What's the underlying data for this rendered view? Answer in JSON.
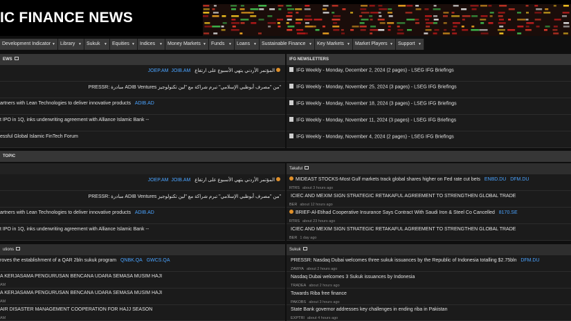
{
  "banner": {
    "title": "IC FINANCE NEWS"
  },
  "nav": {
    "items": [
      {
        "label": "Development Indicator"
      },
      {
        "label": "Library"
      },
      {
        "label": "Sukuk"
      },
      {
        "label": "Equities"
      },
      {
        "label": "Indices"
      },
      {
        "label": "Money Markets"
      },
      {
        "label": "Funds"
      },
      {
        "label": "Loans"
      },
      {
        "label": "Sustainable Finance"
      },
      {
        "label": "Key Markets"
      },
      {
        "label": "Market Players"
      },
      {
        "label": "Support"
      }
    ]
  },
  "news": {
    "title": "EWS",
    "rows": [
      {
        "text": "المؤتمر الأردني يتهي الأسبوع على ارتفاع",
        "links": [
          "JOEP.AM",
          "JOIB.AM"
        ]
      },
      {
        "text": "PRESSR: مبادرة ADIB Ventures من \"مصرف أبوظبي الإسلامي\" تبرم شراكة مع \"لين تكنولوجيز\"",
        "links": []
      },
      {
        "text": "artners with Lean Technologies to deliver innovative products",
        "links": [
          "ADIB.AD"
        ]
      },
      {
        "text": "t IPO in 1Q, inks underwriting agreement with Alliance Islamic Bank --",
        "links": []
      },
      {
        "text": "essful Global Islamic FinTech Forum",
        "links": []
      }
    ]
  },
  "newsletters": {
    "title": "IFG NEWSLETTERS",
    "rows": [
      {
        "text": "IFG Weekly - Monday, December 2, 2024 (2 pages) - LSEG IFG Briefings"
      },
      {
        "text": "IFG Weekly - Monday, November 25, 2024 (3 pages) - LSEG IFG Briefings"
      },
      {
        "text": "IFG Weekly - Monday, November 18, 2024 (3 pages) - LSEG IFG Briefings"
      },
      {
        "text": "IFG Weekly - Monday, November 11, 2024 (3 pages) - LSEG IFG Briefings"
      },
      {
        "text": "IFG Weekly - Monday, November 4, 2024 (2 pages) - LSEG IFG Briefings"
      }
    ]
  },
  "topic": {
    "title": "TOPIC",
    "rows": [
      {
        "text": "المؤتمر الأردني يتهي الأسبوع على ارتفاع",
        "links": [
          "JOEP.AM",
          "JOIB.AM"
        ]
      },
      {
        "text": "PRESSR: مبادرة ADIB Ventures من \"مصرف أبوظبي الإسلامي\" تبرم شراكة مع \"لين تكنولوجيز\"",
        "links": []
      },
      {
        "text": "artners with Lean Technologies to deliver innovative products",
        "links": [
          "ADIB.AD"
        ]
      },
      {
        "text": "t IPO in 1Q, inks underwriting agreement with Alliance Islamic Bank --",
        "links": []
      }
    ]
  },
  "takaful": {
    "title": "Takaful",
    "rows": [
      {
        "text": "MIDEAST STOCKS-Most Gulf markets track global shares higher on Fed rate cut bets",
        "links": [
          "ENBD.DU",
          "DFM.DU"
        ],
        "source": "RTRS",
        "time": "about 3 hours ago",
        "icon": true
      },
      {
        "text": "ICIEC AND MEXIM SIGN STRATEGIC RETAKAFUL AGREEMENT TO STRENGTHEN GLOBAL TRADE",
        "links": [],
        "source": "BER",
        "time": "about 12 hours ago",
        "icon": false
      },
      {
        "text": "BRIEF-Al-Etihad Cooperative Insurance Says Contract With Saudi Iron & Steel Co Cancelled",
        "links": [
          "8170.SE"
        ],
        "source": "RTRS",
        "time": "about 23 hours ago",
        "icon": true
      },
      {
        "text": "ICIEC AND MEXIM SIGN STRATEGIC RETAKAFUL AGREEMENT TO STRENGTHEN GLOBAL TRADE",
        "links": [],
        "source": "BER",
        "time": "1 day ago",
        "icon": false
      }
    ]
  },
  "institutions": {
    "title": "utions",
    "rows": [
      {
        "text": "roves the establishment of a QAR 2bln sukuk program",
        "links": [
          "QNBK.QA",
          "GWCS.QA"
        ]
      },
      {
        "text": "A KERJASAMA PENGURUSAN BENCANA UDARA SEMASA MUSIM HAJI",
        "links": [],
        "sub": "AM"
      },
      {
        "text": "A KERJASAMA PENGURUSAN BENCANA UDARA SEMASA MUSIM HAJI",
        "links": [],
        "sub": "AM"
      },
      {
        "text": "AIR DISASTER MANAGEMENT COOPERATION FOR HAJJ SEASON",
        "links": [],
        "sub": "AM"
      }
    ]
  },
  "sukuk": {
    "title": "Sukuk",
    "rows": [
      {
        "text": "PRESSR: Nasdaq Dubai welcomes three sukuk issuances by the Republic of Indonesia totalling $2.75bln",
        "links": [
          "DFM.DU"
        ],
        "source": "ZAWYA",
        "time": "about 2 hours ago"
      },
      {
        "text": "Nasdaq Dubai welcomes 3 Sukuk issuances by Indonesia",
        "links": [],
        "source": "TRADEA",
        "time": "about 2 hours ago"
      },
      {
        "text": "Towards Riba free finance",
        "links": [],
        "source": "PAKOBS",
        "time": "about 3 hours ago"
      },
      {
        "text": "State Bank governor addresses key challenges in ending riba in Pakistan",
        "links": [],
        "source": "EXPTRI",
        "time": "about 4 hours ago"
      }
    ]
  },
  "colors": {
    "link": "#4aa3ff",
    "icon_orange": "#e0902a",
    "header_bg": "#363636",
    "row_bg": "#1b1b1b"
  }
}
